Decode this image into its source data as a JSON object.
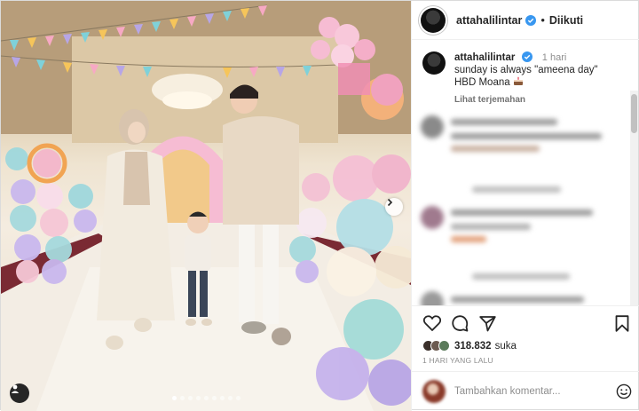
{
  "post": {
    "username": "attahalilintar",
    "follow_status": "Diikuti",
    "separator": "•"
  },
  "caption": {
    "username": "attahalilintar",
    "time": "1 hari",
    "text": "sunday is always \"ameena day\"\nHBD Moana",
    "translate": "Lihat terjemahan"
  },
  "likes": {
    "count": "318.832",
    "label": "suka"
  },
  "post_time": "1 HARI YANG LALU",
  "add_comment": {
    "placeholder": "Tambahkan komentar..."
  },
  "carousel": {
    "total": 9,
    "active_index": 0
  },
  "colors": {
    "verified": "#3897f0",
    "text": "#262626",
    "muted": "#8e8e8e",
    "border": "#dbdbdb"
  },
  "icons": {
    "like": "heart-icon",
    "comment": "comment-bubble-icon",
    "share": "paper-plane-icon",
    "save": "bookmark-icon",
    "next": "chevron-right-icon",
    "tags": "user-tag-icon",
    "emoji": "smiley-icon"
  }
}
